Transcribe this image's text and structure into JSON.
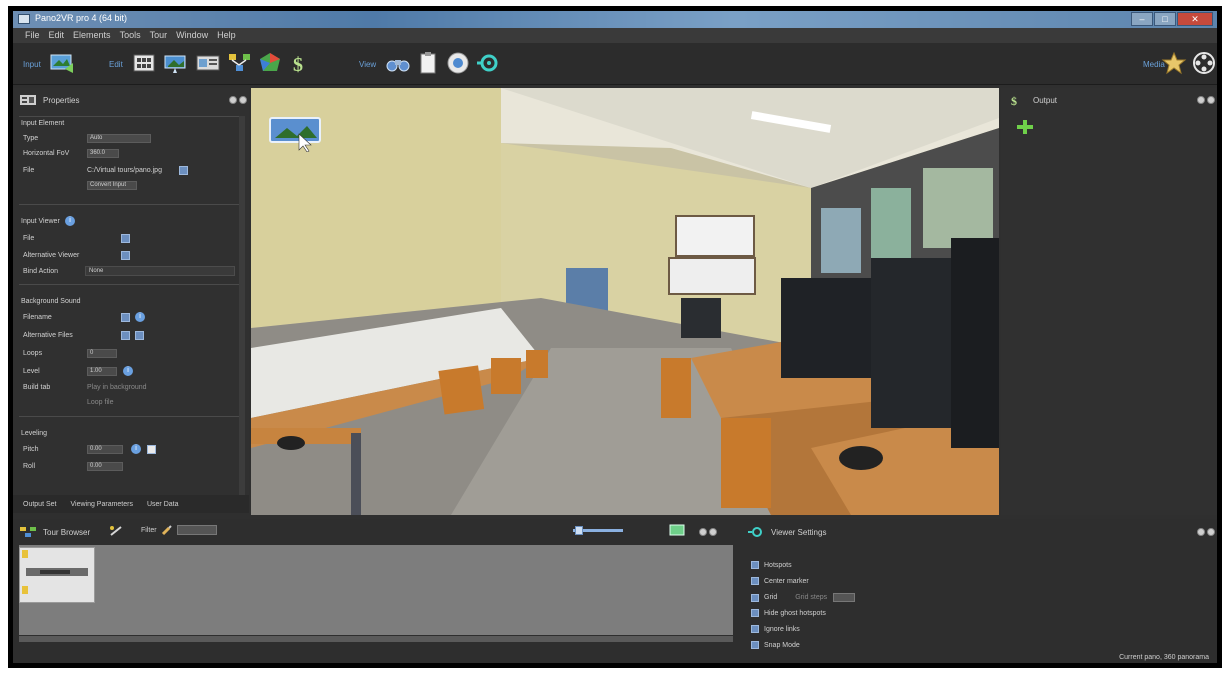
{
  "window": {
    "title": "Pano2VR pro 4 (64 bit)"
  },
  "menu": [
    "File",
    "Edit",
    "Elements",
    "Tools",
    "Tour",
    "Window",
    "Help"
  ],
  "toolbar": {
    "group_input": "Input",
    "group_edit": "Edit",
    "group_view": "View",
    "group_media": "Media"
  },
  "properties": {
    "title": "Properties",
    "section_input": "Input Element",
    "type_label": "Type",
    "type_value": "Auto",
    "hres_label": "Horizontal FoV",
    "hres_value": "360.0",
    "file_label": "File",
    "file_value": "C:/Virtual tours/pano.jpg",
    "convert_btn": "Convert Input",
    "section_viewer": "Input Viewer",
    "viewer_file": "File",
    "viewer_alt": "Alternative Viewer",
    "viewer_bind": "Bind Action",
    "viewer_bind_value": "None",
    "section_bg": "Background Sound",
    "bg_filename": "Filename",
    "bg_alt": "Alternative Files",
    "bg_loops": "Loops",
    "bg_loops_value": "0",
    "bg_level": "Level",
    "bg_level_value": "1.00",
    "bg_build": "Build tab",
    "bg_opt1": "Play in background",
    "bg_opt2": "Loop file",
    "section_leveling": "Leveling",
    "lev_pitch": "Pitch",
    "lev_pitch_value": "0.00",
    "lev_roll": "Roll",
    "lev_roll_value": "0.00"
  },
  "bottom_tabs": [
    "Output Set",
    "Viewing Parameters",
    "User Data"
  ],
  "outline": {
    "title": "Output"
  },
  "tour": {
    "title": "Tour Browser",
    "filter": "Filter"
  },
  "settings": {
    "title": "Viewer Settings",
    "items": [
      "Hotspots",
      "Center marker",
      "Grid",
      "Hide ghost hotspots",
      "Ignore links",
      "Snap Mode"
    ],
    "grid_extra": "Grid steps",
    "status": "Current pano, 360 panorama"
  }
}
